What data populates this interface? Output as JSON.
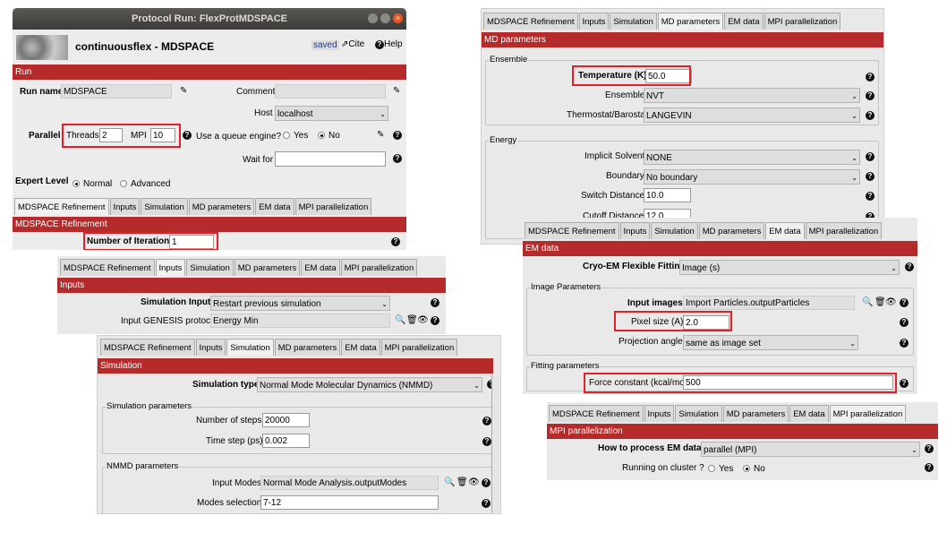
{
  "window": {
    "title": "Protocol Run: FlexProtMDSPACE"
  },
  "header": {
    "protocol_name": "continuousflex - MDSPACE",
    "saved": "saved",
    "cite": "Cite",
    "help": "Help"
  },
  "run": {
    "section": "Run",
    "run_name_label": "Run name",
    "run_name_value": "MDSPACE",
    "comment_label": "Comment",
    "host_label": "Host",
    "host_value": "localhost",
    "parallel_label": "Parallel",
    "threads_label": "Threads",
    "threads_value": "2",
    "mpi_label": "MPI",
    "mpi_value": "10",
    "queue_label": "Use a queue engine?",
    "yes": "Yes",
    "no": "No",
    "wait_label": "Wait for",
    "expert_label": "Expert Level",
    "normal": "Normal",
    "advanced": "Advanced"
  },
  "tabs": [
    "MDSPACE Refinement",
    "Inputs",
    "Simulation",
    "MD parameters",
    "EM data",
    "MPI parallelization"
  ],
  "refinement": {
    "section": "MDSPACE Refinement",
    "iterations_label": "Number of Iterations",
    "iterations_value": "1"
  },
  "inputs": {
    "section": "Inputs",
    "sim_inputs_label": "Simulation Inputs",
    "sim_inputs_value": "Restart previous simulation",
    "genesis_label": "Input GENESIS protocol",
    "genesis_value": "Energy Min"
  },
  "simulation": {
    "section": "Simulation",
    "type_label": "Simulation type",
    "type_value": "Normal Mode Molecular Dynamics (NMMD)",
    "params_group": "Simulation parameters",
    "steps_label": "Number of steps",
    "steps_value": "20000",
    "timestep_label": "Time step (ps)",
    "timestep_value": "0.002",
    "nmmd_group": "NMMD parameters",
    "modes_label": "Input Modes",
    "modes_value": "Normal Mode Analysis.outputModes",
    "modes_sel_label": "Modes selection",
    "modes_sel_value": "7-12"
  },
  "md": {
    "section": "MD parameters",
    "ensemble_group": "Ensemble",
    "temp_label": "Temperature (K)",
    "temp_value": "50.0",
    "ensemble_label": "Ensemble",
    "ensemble_value": "NVT",
    "thermo_label": "Thermostat/Barostat",
    "thermo_value": "LANGEVIN",
    "energy_group": "Energy",
    "solvent_label": "Implicit Solvent",
    "solvent_value": "NONE",
    "boundary_label": "Boundary",
    "boundary_value": "No boundary",
    "switch_label": "Switch Distance",
    "switch_value": "10.0",
    "cutoff_label": "Cutoff Distance",
    "cutoff_value": "12.0"
  },
  "em": {
    "section": "EM data",
    "fitting_label": "Cryo-EM Flexible Fitting",
    "fitting_value": "Image (s)",
    "image_group": "Image Parameters",
    "input_images_label": "Input images",
    "input_images_value": "Import Particles.outputParticles",
    "pixel_label": "Pixel size (A)",
    "pixel_value": "2.0",
    "angles_label": "Projection angles",
    "angles_value": "same as image set",
    "fitting_group": "Fitting parameters",
    "force_label": "Force constant (kcal/mol)",
    "force_value": "500"
  },
  "mpi": {
    "section": "MPI parallelization",
    "process_label": "How to process EM data ?",
    "process_value": "parallel (MPI)",
    "cluster_label": "Running on cluster ?",
    "yes": "Yes",
    "no": "No"
  },
  "colors": {
    "section_bar": "#b52a2a",
    "highlight": "#e41f2a",
    "titlebar": "#4a4944",
    "close": "#e95420"
  }
}
